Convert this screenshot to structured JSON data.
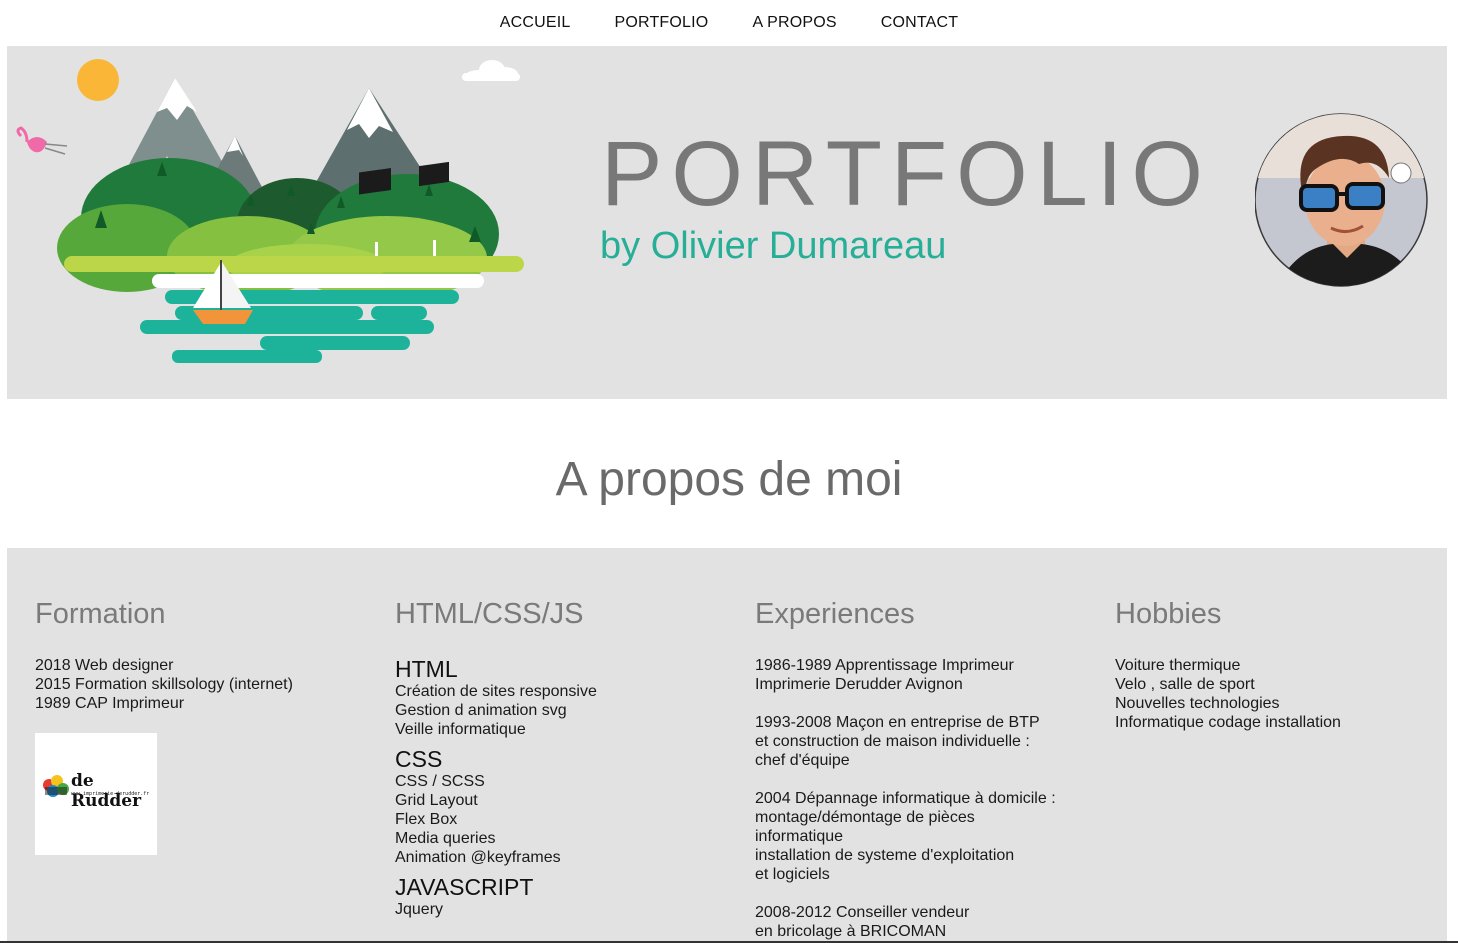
{
  "nav": {
    "items": [
      "ACCUEIL",
      "PORTFOLIO",
      "A PROPOS",
      "CONTACT"
    ]
  },
  "hero": {
    "title": "PORTFOLIO",
    "subtitle": "by Olivier Dumareau",
    "colors": {
      "background": "#e2e2e2",
      "title": "#787878",
      "subtitle": "#26ae96"
    }
  },
  "about": {
    "title": "A propos de moi"
  },
  "columns": {
    "formation": {
      "title": "Formation",
      "lines": [
        "2018 Web designer",
        "2015 Formation skillsology (internet)",
        "1989 CAP Imprimeur"
      ],
      "logo": {
        "name": "de Rudder",
        "url_text": "www.imprimerie-derudder.fr"
      }
    },
    "skills": {
      "title": "HTML/CSS/JS",
      "groups": [
        {
          "title": "HTML",
          "items": [
            "Création de sites responsive",
            "Gestion d animation svg",
            "Veille informatique"
          ]
        },
        {
          "title": "CSS",
          "items": [
            "CSS / SCSS",
            "Grid Layout",
            "Flex Box",
            "Media queries",
            "Animation @keyframes"
          ]
        },
        {
          "title": "JAVASCRIPT",
          "items": [
            "Jquery"
          ]
        }
      ]
    },
    "experiences": {
      "title": "Experiences",
      "blocks": [
        [
          "1986-1989 Apprentissage Imprimeur",
          "Imprimerie Derudder Avignon"
        ],
        [
          "1993-2008 Maçon en entreprise de BTP",
          "et construction de maison individuelle :",
          "chef d'équipe"
        ],
        [
          "2004 Dépannage informatique à domicile :",
          "montage/démontage de pièces",
          "informatique",
          "installation de systeme d'exploitation",
          "et logiciels"
        ],
        [
          "2008-2012 Conseiller vendeur",
          "en bricolage à BRICOMAN"
        ]
      ]
    },
    "hobbies": {
      "title": "Hobbies",
      "lines": [
        "Voiture thermique",
        "Velo , salle de sport",
        "Nouvelles technologies",
        "Informatique codage installation"
      ]
    }
  }
}
